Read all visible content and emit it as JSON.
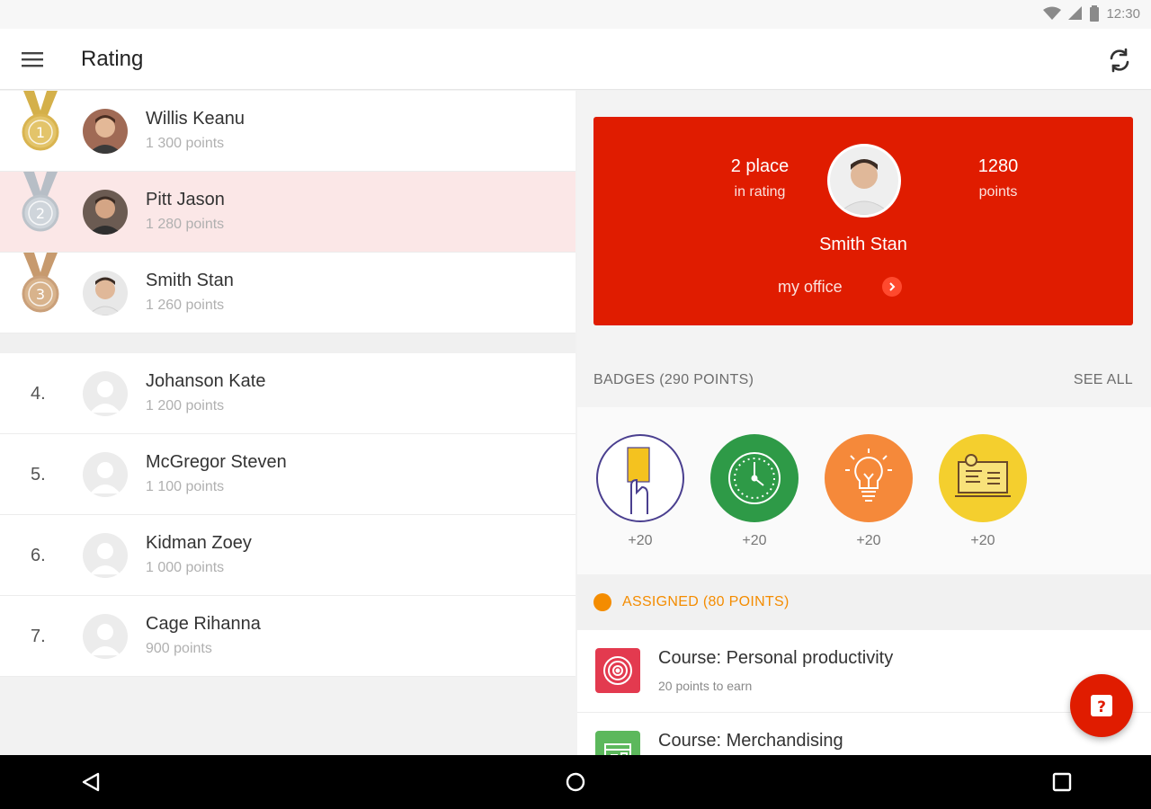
{
  "status_bar": {
    "time": "12:30",
    "icons": [
      "wifi-icon",
      "signal-icon",
      "battery-icon"
    ]
  },
  "app_bar": {
    "title": "Rating",
    "left_icon": "hamburger-menu-icon",
    "right_icon": "refresh-icon"
  },
  "colors": {
    "brand_red": "#e01c00",
    "highlight_row": "#fbe7e7",
    "assigned_orange": "#f48c00",
    "gold": "#d4b04a",
    "silver": "#b7bec6",
    "bronze": "#c79a6e"
  },
  "leaderboard": {
    "top": [
      {
        "name": "Willis Keanu",
        "points": "1 300 points",
        "medal": "gold-medal-icon",
        "medal_number": "1"
      },
      {
        "name": "Pitt Jason",
        "points": "1 280 points",
        "medal": "silver-medal-icon",
        "medal_number": "2"
      },
      {
        "name": "Smith Stan",
        "points": "1 260 points",
        "medal": "bronze-medal-icon",
        "medal_number": "3"
      }
    ],
    "rest": [
      {
        "rank": "4.",
        "name": "Johanson Kate",
        "points": "1 200 points"
      },
      {
        "rank": "5.",
        "name": "McGregor Steven",
        "points": "1 100 points"
      },
      {
        "rank": "6.",
        "name": "Kidman Zoey",
        "points": "1 000 points"
      },
      {
        "rank": "7.",
        "name": "Cage Rihanna",
        "points": "900 points"
      }
    ]
  },
  "profile": {
    "place_value": "2 place",
    "place_label": "in rating",
    "points_value": "1280",
    "points_label": "points",
    "name": "Smith Stan",
    "office_link": "my office"
  },
  "badges": {
    "title": "BADGES (290 POINTS)",
    "see_all": "SEE ALL",
    "items": [
      {
        "icon": "yellow-card-icon",
        "points": "+20",
        "color": "#ffffff"
      },
      {
        "icon": "clock-icon",
        "points": "+20",
        "color": "#2e9a47"
      },
      {
        "icon": "lightbulb-icon",
        "points": "+20",
        "color": "#f5893a"
      },
      {
        "icon": "certificate-icon",
        "points": "+20",
        "color": "#f4cf2e"
      }
    ]
  },
  "assigned": {
    "title": "ASSIGNED (80 POINTS)",
    "courses": [
      {
        "title": "Course: Personal productivity",
        "subtitle": "20 points to earn",
        "icon": "target-icon",
        "color": "#e33a4f"
      },
      {
        "title": "Course: Merchandising",
        "subtitle": "",
        "icon": "store-icon",
        "color": "#5cb85c"
      }
    ]
  },
  "fab": {
    "icon": "help-question-icon"
  },
  "nav_bar": {
    "icons": [
      "back-icon",
      "home-icon",
      "recents-icon"
    ]
  }
}
